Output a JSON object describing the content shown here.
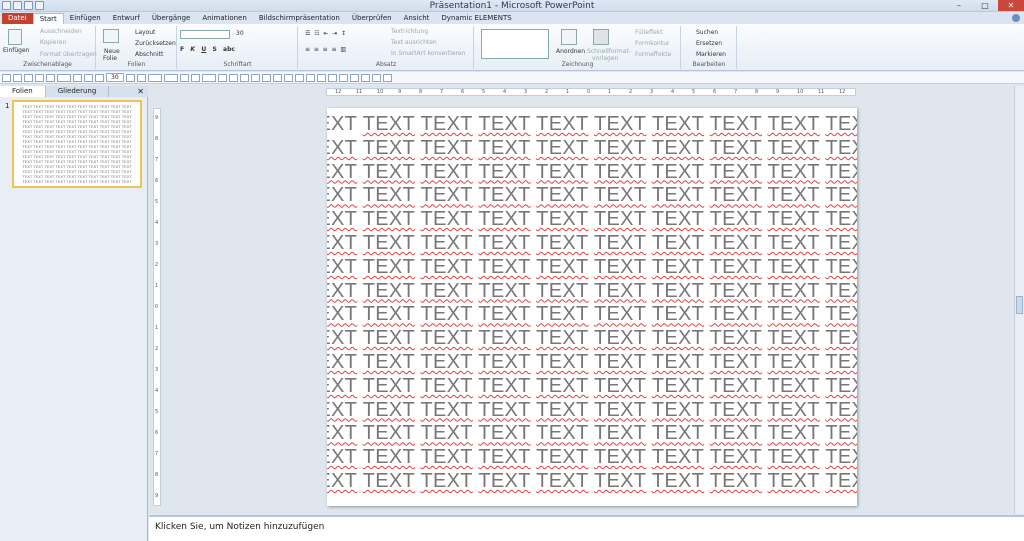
{
  "window": {
    "title": "Präsentation1 - Microsoft PowerPoint"
  },
  "tabs": [
    "Datei",
    "Start",
    "Einfügen",
    "Entwurf",
    "Übergänge",
    "Animationen",
    "Bildschirmpräsentation",
    "Überprüfen",
    "Ansicht",
    "Dynamic ELEMENTS"
  ],
  "ribbon": {
    "clipboard": {
      "paste": "Einfügen",
      "cut": "Ausschneiden",
      "copy": "Kopieren",
      "format_painter": "Format übertragen",
      "label": "Zwischenablage"
    },
    "slides": {
      "new_slide_1": "Neue",
      "new_slide_2": "Folie",
      "layout": "Layout",
      "reset": "Zurücksetzen",
      "section": "Abschnitt",
      "label": "Folien"
    },
    "font": {
      "size": "30",
      "label": "Schriftart"
    },
    "paragraph": {
      "direction": "Textrichtung",
      "align": "Text ausrichten",
      "smartart": "In SmartArt konvertieren",
      "label": "Absatz"
    },
    "drawing": {
      "arrange": "Anordnen",
      "quickstyles_1": "Schnellformat-",
      "quickstyles_2": "vorlagen",
      "fill": "Fülleffekt",
      "outline": "Formkontur",
      "effects": "Formeffekte",
      "label": "Zeichnung"
    },
    "editing": {
      "find": "Suchen",
      "replace": "Ersetzen",
      "select": "Markieren",
      "label": "Bearbeiten"
    }
  },
  "drawing_toolbar": {
    "font_size": "30"
  },
  "panes": {
    "slides_tab": "Folien",
    "outline_tab": "Gliederung"
  },
  "thumbnail": {
    "number": "1"
  },
  "slide": {
    "word": "TEXT",
    "rows": 16,
    "cols": 10
  },
  "notes": {
    "placeholder": "Klicken Sie, um Notizen hinzuzufügen"
  },
  "ruler_h_labels": [
    "12",
    "11",
    "10",
    "9",
    "8",
    "7",
    "6",
    "5",
    "4",
    "3",
    "2",
    "1",
    "0",
    "1",
    "2",
    "3",
    "4",
    "5",
    "6",
    "7",
    "8",
    "9",
    "10",
    "11",
    "12"
  ],
  "ruler_v_labels": [
    "9",
    "8",
    "7",
    "6",
    "5",
    "4",
    "3",
    "2",
    "1",
    "0",
    "1",
    "2",
    "3",
    "4",
    "5",
    "6",
    "7",
    "8",
    "9"
  ]
}
